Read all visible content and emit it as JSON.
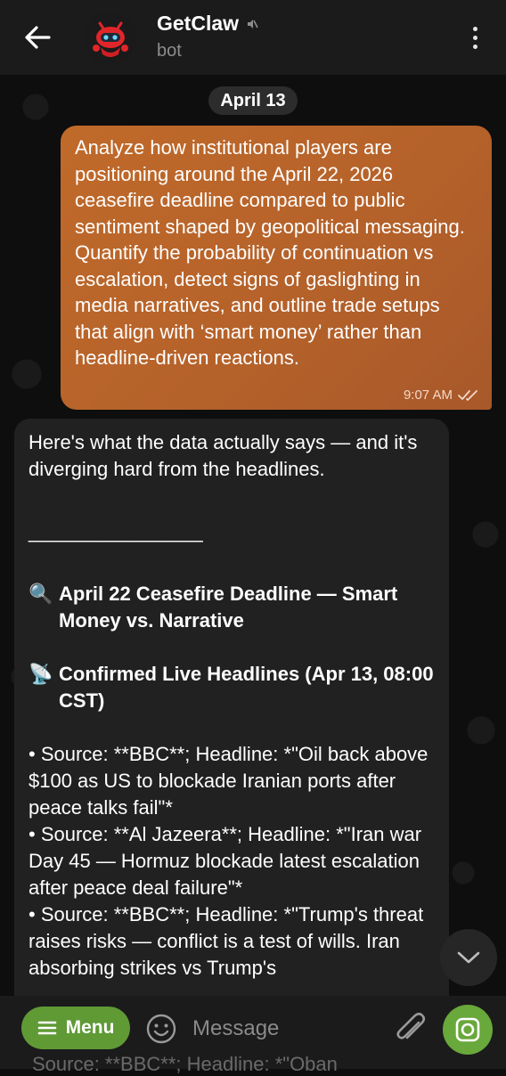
{
  "header": {
    "title": "GetClaw",
    "subtitle": "bot",
    "back_icon": "arrow-left-icon",
    "muted_icon": "mute-icon",
    "menu_icon": "more-vertical-icon"
  },
  "date_pill": "April 13",
  "outgoing": {
    "text": "Analyze how institutional players are positioning around the April 22, 2026 ceasefire deadline compared to public sentiment shaped by geopolitical messaging. Quantify the probability of continuation vs escalation, detect signs of gaslighting in media narratives, and outline trade setups that align with ‘smart money’ rather than headline-driven reactions.",
    "time": "9:07 AM",
    "status_icon": "double-check-icon"
  },
  "incoming": {
    "intro": "Here's what the data actually says — and it's diverging hard from the headlines.",
    "rule": "________________",
    "heading1_icon": "🔍",
    "heading1": "April 22 Ceasefire Deadline — Smart Money vs. Narrative",
    "heading2_icon": "📡",
    "heading2": "Confirmed Live Headlines (Apr 13, 08:00 CST)",
    "items": [
      "• Source: **BBC**; Headline: *\"Oil back above $100 as US to blockade Iranian ports after peace talks fail\"*",
      "• Source: **Al Jazeera**; Headline: *\"Iran war Day 45 — Hormuz blockade latest escalation after peace deal failure\"*",
      "• Source: **BBC**; Headline: *\"Trump's threat raises risks — conflict is a test of wills. Iran absorbing strikes vs Trump's"
    ],
    "cut_line": "Source: **BBC**; Headline: *\"Oban"
  },
  "bottom_bar": {
    "menu_label": "Menu",
    "input_placeholder": "Message",
    "emoji_icon": "emoji-icon",
    "attach_icon": "paperclip-icon",
    "camera_icon": "camera-icon"
  },
  "colors": {
    "outgoing_bubble": "#b4612a",
    "incoming_bubble": "#212121",
    "accent_green": "#69a83b",
    "header_bg": "#1b1b1b"
  }
}
